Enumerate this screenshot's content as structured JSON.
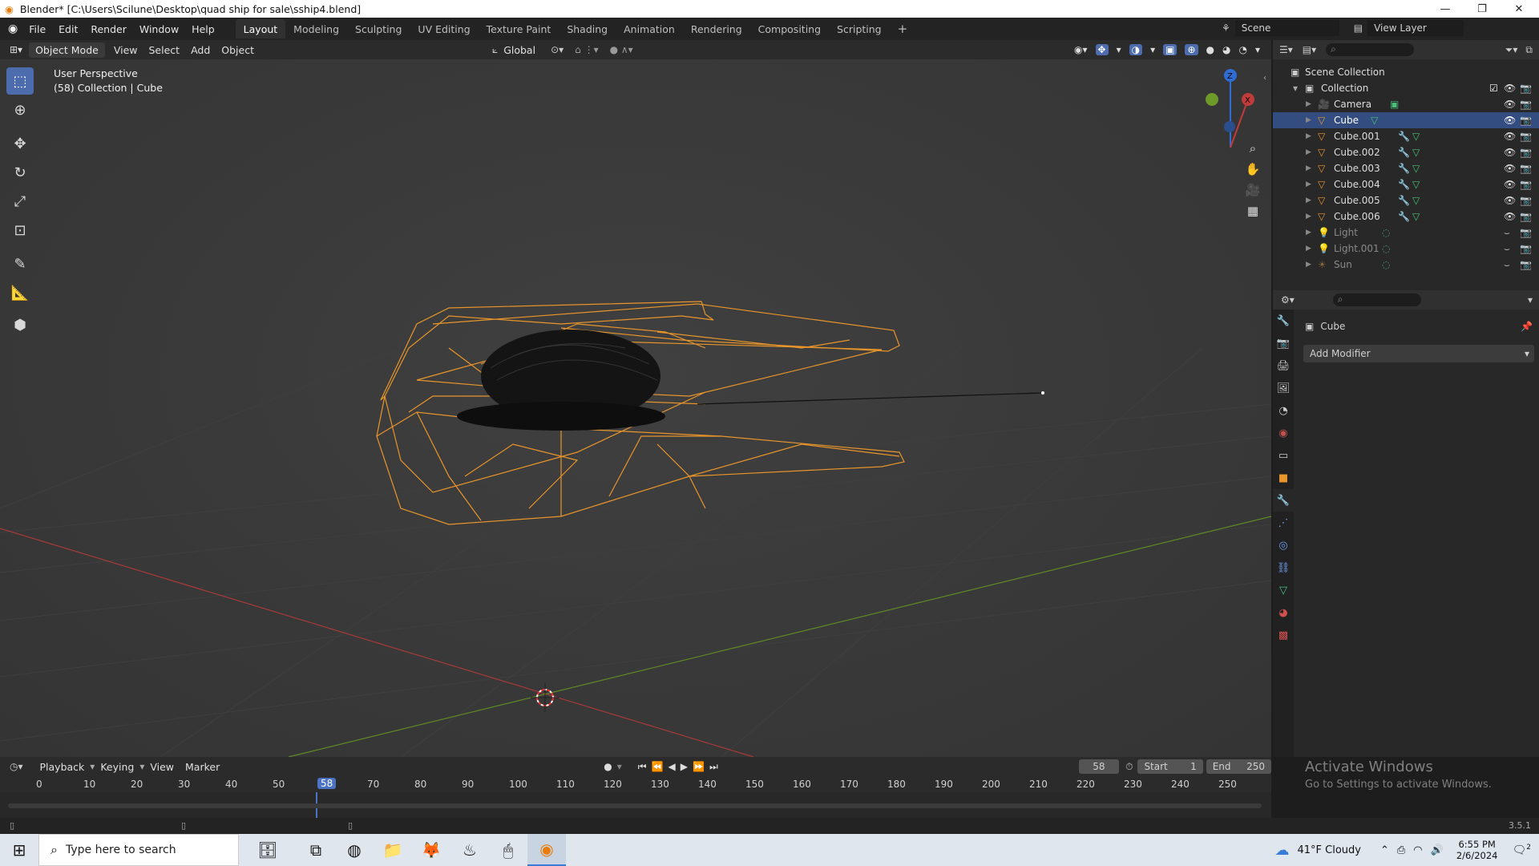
{
  "window": {
    "title": "Blender* [C:\\Users\\Scilune\\Desktop\\quad ship for sale\\sship4.blend]"
  },
  "menus": [
    "File",
    "Edit",
    "Render",
    "Window",
    "Help"
  ],
  "workspaces": [
    "Layout",
    "Modeling",
    "Sculpting",
    "UV Editing",
    "Texture Paint",
    "Shading",
    "Animation",
    "Rendering",
    "Compositing",
    "Scripting"
  ],
  "active_workspace": "Layout",
  "scene": {
    "name": "Scene",
    "view_layer": "View Layer"
  },
  "viewport": {
    "mode": "Object Mode",
    "menus": [
      "View",
      "Select",
      "Add",
      "Object"
    ],
    "orientation": "Global",
    "perspective_label": "User Perspective",
    "collection_label": "(58) Collection | Cube",
    "gizmo_axes": {
      "z": "Z",
      "x": "X"
    },
    "colors": {
      "selection": "#e8952b",
      "x_axis": "#c23b3b",
      "y_axis": "#6e9a2a",
      "accent": "#4c6cae"
    }
  },
  "outliner": {
    "root": "Scene Collection",
    "collection": "Collection",
    "items": [
      {
        "name": "Camera",
        "icon": "camera-icon",
        "selected": false,
        "dim": false
      },
      {
        "name": "Cube",
        "icon": "mesh-icon",
        "selected": true,
        "dim": false
      },
      {
        "name": "Cube.001",
        "icon": "mesh-icon",
        "selected": false,
        "dim": false
      },
      {
        "name": "Cube.002",
        "icon": "mesh-icon",
        "selected": false,
        "dim": false
      },
      {
        "name": "Cube.003",
        "icon": "mesh-icon",
        "selected": false,
        "dim": false
      },
      {
        "name": "Cube.004",
        "icon": "mesh-icon",
        "selected": false,
        "dim": false
      },
      {
        "name": "Cube.005",
        "icon": "mesh-icon",
        "selected": false,
        "dim": false
      },
      {
        "name": "Cube.006",
        "icon": "mesh-icon",
        "selected": false,
        "dim": false
      },
      {
        "name": "Light",
        "icon": "light-icon",
        "selected": false,
        "dim": true
      },
      {
        "name": "Light.001",
        "icon": "light-icon",
        "selected": false,
        "dim": true
      },
      {
        "name": "Sun",
        "icon": "sun-icon",
        "selected": false,
        "dim": true
      }
    ]
  },
  "properties": {
    "object_name": "Cube",
    "add_modifier": "Add Modifier"
  },
  "timeline": {
    "menus": [
      "Playback",
      "Keying",
      "View",
      "Marker"
    ],
    "current_frame": "58",
    "start_label": "Start",
    "start": "1",
    "end_label": "End",
    "end": "250",
    "ticks": [
      "0",
      "10",
      "20",
      "30",
      "40",
      "50",
      "58",
      "70",
      "80",
      "90",
      "100",
      "110",
      "120",
      "130",
      "140",
      "150",
      "160",
      "170",
      "180",
      "190",
      "200",
      "210",
      "220",
      "230",
      "240",
      "250"
    ]
  },
  "watermark": {
    "line1": "Activate Windows",
    "line2": "Go to Settings to activate Windows."
  },
  "version": "3.5.1",
  "taskbar": {
    "search_placeholder": "Type here to search",
    "weather": "41°F  Cloudy",
    "time": "6:55 PM",
    "date": "2/6/2024",
    "notifications": "2"
  }
}
